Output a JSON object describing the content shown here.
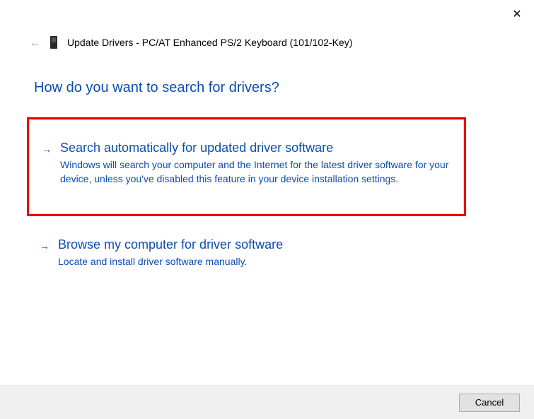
{
  "close_label": "✕",
  "header": {
    "back_arrow": "←",
    "title": "Update Drivers - PC/AT Enhanced PS/2 Keyboard (101/102-Key)"
  },
  "heading": "How do you want to search for drivers?",
  "options": [
    {
      "arrow": "→",
      "title": "Search automatically for updated driver software",
      "description": "Windows will search your computer and the Internet for the latest driver software for your device, unless you've disabled this feature in your device installation settings."
    },
    {
      "arrow": "→",
      "title": "Browse my computer for driver software",
      "description": "Locate and install driver software manually."
    }
  ],
  "footer": {
    "cancel_label": "Cancel"
  }
}
